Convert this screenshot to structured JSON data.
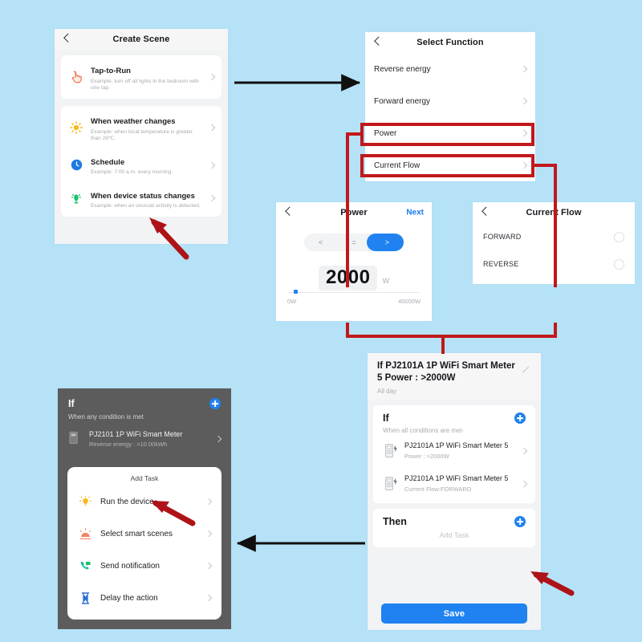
{
  "canvas": {
    "background": "#b5e2f7",
    "accent_blue": "#1f82f0",
    "highlight_red": "#c1181b",
    "arrow_black": "#101010"
  },
  "create_scene": {
    "title": "Create Scene",
    "back_icon": "chevron-left-icon",
    "items": [
      {
        "icon": "tap-hand-icon",
        "title": "Tap-to-Run",
        "subtitle": "Example: turn off all lights in the bedroom with one tap."
      },
      {
        "icon": "sun-icon",
        "title": "When weather changes",
        "subtitle": "Example: when local temperature is greater than 28℃."
      },
      {
        "icon": "clock-icon",
        "title": "Schedule",
        "subtitle": "Example: 7:00 a.m. every morning."
      },
      {
        "icon": "motion-sensor-icon",
        "title": "When device status changes",
        "subtitle": "Example: when an unusual activity is detected."
      }
    ]
  },
  "select_function": {
    "title": "Select Function",
    "back_icon": "chevron-left-icon",
    "items": [
      {
        "label": "Reverse energy",
        "highlighted": false
      },
      {
        "label": "Forward energy",
        "highlighted": false
      },
      {
        "label": "Power",
        "highlighted": true
      },
      {
        "label": "Current Flow",
        "highlighted": true
      }
    ]
  },
  "power": {
    "title": "Power",
    "back_icon": "chevron-left-icon",
    "next_label": "Next",
    "operators": [
      "<",
      "=",
      ">"
    ],
    "selected_operator": ">",
    "value": "2000",
    "unit": "W",
    "slider_min_label": "0W",
    "slider_max_label": "40000W",
    "slider_percent": 5
  },
  "current_flow": {
    "title": "Current Flow",
    "back_icon": "chevron-left-icon",
    "options": [
      {
        "label": "FORWARD",
        "selected": false
      },
      {
        "label": "REVERSE",
        "selected": false
      }
    ]
  },
  "condition_panel": {
    "header_title": "If PJ2101A 1P WiFi Smart Meter  5 Power : >2000W",
    "header_subtitle": "All day",
    "edit_icon": "pencil-icon",
    "if_section": {
      "title": "If",
      "subtitle": "When all conditions are met·",
      "add_icon": "plus-circle-icon",
      "items": [
        {
          "icon": "smart-meter-icon",
          "name": "PJ2101A 1P WiFi Smart Meter 5",
          "detail": "Power : >2000W"
        },
        {
          "icon": "smart-meter-icon",
          "name": "PJ2101A 1P WiFi Smart Meter 5",
          "detail": "Current Flow:FORWARD"
        }
      ]
    },
    "then_section": {
      "title": "Then",
      "add_icon": "plus-circle-icon",
      "hint": "Add Task"
    },
    "save_label": "Save"
  },
  "add_task_panel": {
    "if_title": "If",
    "if_subtitle": "When any condition is met",
    "add_icon": "plus-circle-icon",
    "condition_item": {
      "icon": "smart-meter-icon",
      "name": "PJ2101 1P WiFi Smart Meter",
      "detail": "Reverse energy : >10.00kWh"
    },
    "sheet_title": "Add Task",
    "tasks": [
      {
        "icon": "bulb-icon",
        "label": "Run the device"
      },
      {
        "icon": "scene-icon",
        "label": "Select smart scenes"
      },
      {
        "icon": "phone-notify-icon",
        "label": "Send notification"
      },
      {
        "icon": "hourglass-icon",
        "label": "Delay the action"
      }
    ]
  }
}
